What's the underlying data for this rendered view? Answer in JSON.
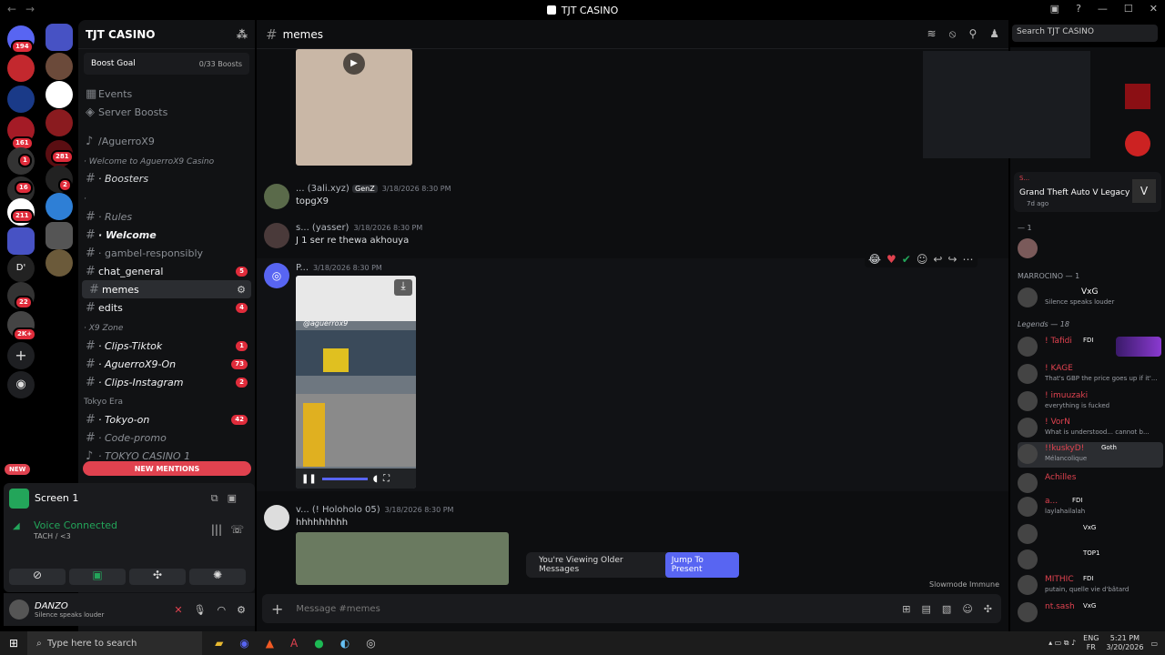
{
  "window": {
    "title": "TJT CASINO"
  },
  "guild_badges": [
    "194",
    "161",
    "281",
    "2",
    "16",
    "1",
    "211",
    "22",
    "2K+"
  ],
  "guild_letter": "D'",
  "server": {
    "name": "TJT CASINO",
    "boost_goal": "Boost Goal",
    "boost_count": "0/33 Boosts"
  },
  "nav_items": [
    "Events",
    "Server Boosts"
  ],
  "channels": [
    {
      "label": "/AguerroX9",
      "counter": ""
    },
    {
      "label": "· Welcome to AguerroX9 Casino",
      "counter": ""
    },
    {
      "label": "· Boosters",
      "counter": ""
    },
    {
      "label": "·",
      "counter": ""
    },
    {
      "label": "· Rules",
      "counter": ""
    },
    {
      "label": "· Welcome",
      "counter": ""
    },
    {
      "label": "· gambel-responsibly",
      "counter": ""
    },
    {
      "label": "chat_general",
      "counter": "5"
    },
    {
      "label": "memes",
      "counter": ""
    },
    {
      "label": "edits",
      "counter": "4"
    },
    {
      "label": "· X9 Zone",
      "counter": ""
    },
    {
      "label": "· Clips-Tiktok",
      "counter": "1"
    },
    {
      "label": "· AguerroX9-On",
      "counter": "73"
    },
    {
      "label": "· Clips-Instagram",
      "counter": "2"
    },
    {
      "label": "Tokyo Era",
      "counter": ""
    },
    {
      "label": "· Tokyo-on",
      "counter": "42"
    },
    {
      "label": "· Code-promo",
      "counter": ""
    },
    {
      "label": "· TOKYO CASINO 1",
      "counter": ""
    }
  ],
  "new_mentions": "NEW MENTIONS",
  "new_pill": "NEW",
  "screen_share": {
    "title": "Screen 1"
  },
  "voice": {
    "status": "Voice Connected",
    "channel": "TACH / <3"
  },
  "user": {
    "name": "DANZO",
    "status": "Silence speaks louder"
  },
  "channel_header": {
    "name": "memes"
  },
  "search": {
    "placeholder": "Search TJT CASINO"
  },
  "messages": [
    {
      "author": "... (3ali.xyz)",
      "tag": "GenZ",
      "time": "3/18/2026 8:30 PM",
      "text": "topgX9"
    },
    {
      "author": "s... (yasser)",
      "tag": "",
      "time": "3/18/2026 8:30 PM",
      "text": "J 1 ser re thewa akhouya"
    },
    {
      "author": "P...",
      "tag": "",
      "time": "3/18/2026 8:30 PM",
      "text": ""
    },
    {
      "author": "v... (! Holoholo 05)",
      "tag": "",
      "time": "3/18/2026 8:30 PM",
      "text": "hhhhhhhhh"
    }
  ],
  "video_caption": "@aguerrox9",
  "older_bar": {
    "text": "You're Viewing Older Messages",
    "button": "Jump To Present"
  },
  "slowmode": "Slowmode Immune",
  "composer": {
    "placeholder": "Message #memes"
  },
  "activity": {
    "title": "Grand Theft Auto V Legacy",
    "time": "7d ago",
    "prefix": "S..."
  },
  "member_groups": [
    {
      "label": "MARROCINO — 1"
    },
    {
      "label": "Legends — 18"
    },
    {
      "label": "— 1"
    }
  ],
  "members": [
    {
      "name": "",
      "tag": "VxG",
      "status": "Silence speaks louder"
    },
    {
      "name": "! Tafidi",
      "tag": "FDI",
      "status": ""
    },
    {
      "name": "! KAGE",
      "tag": "",
      "status": "That's GBP the price goes up if it'..."
    },
    {
      "name": "! imuuzaki",
      "tag": "",
      "status": "everything is fucked"
    },
    {
      "name": "! VorN",
      "tag": "",
      "status": "What is understood... cannot b..."
    },
    {
      "name": "!!kuskyD!",
      "tag": "Goth",
      "status": "Mélancolique"
    },
    {
      "name": "Achilles",
      "tag": "",
      "status": ""
    },
    {
      "name": "a...",
      "tag": "FDI",
      "status": "laylahailalah"
    },
    {
      "name": "",
      "tag": "VxG",
      "status": ""
    },
    {
      "name": "",
      "tag": "TOP1",
      "status": ""
    },
    {
      "name": "MITHIC",
      "tag": "FDI",
      "status": "putain, quelle vie d'bâtard"
    },
    {
      "name": "nt.sash",
      "tag": "VxG",
      "status": ""
    }
  ],
  "taskbar": {
    "search": "Type here to search",
    "lang": "ENG",
    "region": "FR",
    "time": "5:21 PM",
    "date": "3/20/2026"
  }
}
